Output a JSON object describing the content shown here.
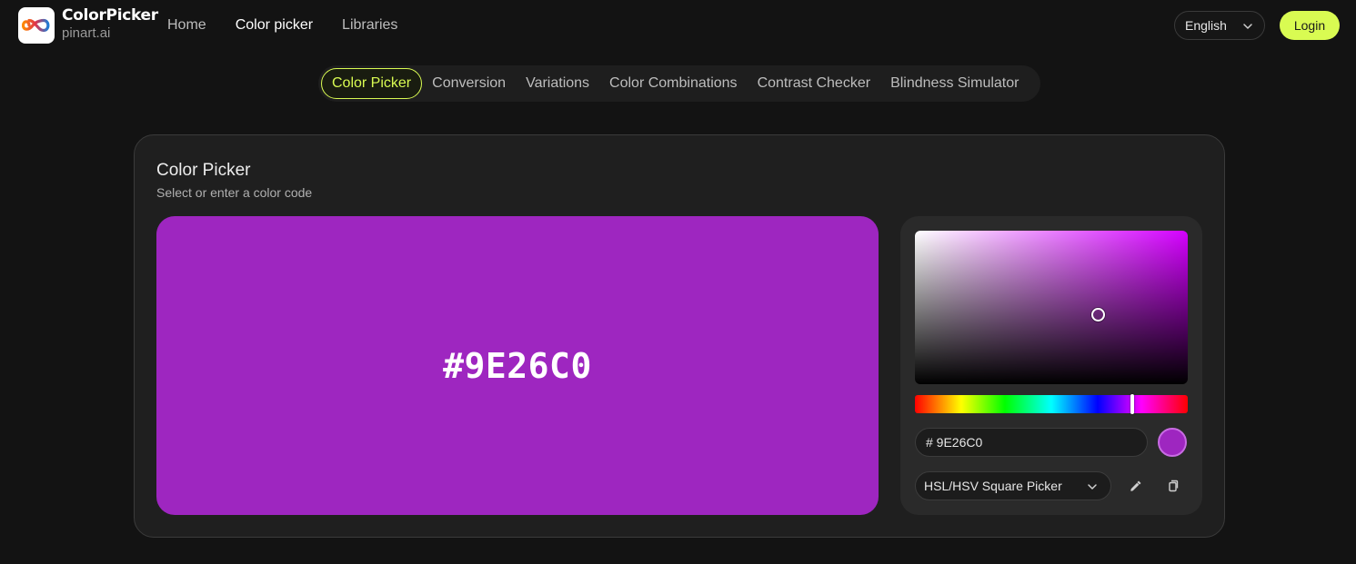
{
  "header": {
    "brand_name": "ColorPicker",
    "brand_sub": "pinart.ai",
    "nav": [
      "Home",
      "Color picker",
      "Libraries"
    ],
    "nav_active": "Color picker",
    "language": "English",
    "login_label": "Login"
  },
  "tabs": [
    {
      "label": "Color Picker",
      "active": true
    },
    {
      "label": "Conversion",
      "active": false
    },
    {
      "label": "Variations",
      "active": false
    },
    {
      "label": "Color Combinations",
      "active": false
    },
    {
      "label": "Contrast Checker",
      "active": false
    },
    {
      "label": "Blindness Simulator",
      "active": false
    }
  ],
  "card": {
    "title": "Color Picker",
    "subtitle": "Select or enter a color code"
  },
  "picker": {
    "preview_hex": "#9E26C0",
    "input_value": "# 9E26C0",
    "mode": "HSL/HSV Square Picker"
  },
  "colors": {
    "background": "#131313",
    "accent": "#d9fb52",
    "selected_color": "#9e26c0"
  },
  "icons": [
    "infinity-logo-icon",
    "chevron-down-icon",
    "eyedropper-icon",
    "copy-icon"
  ]
}
